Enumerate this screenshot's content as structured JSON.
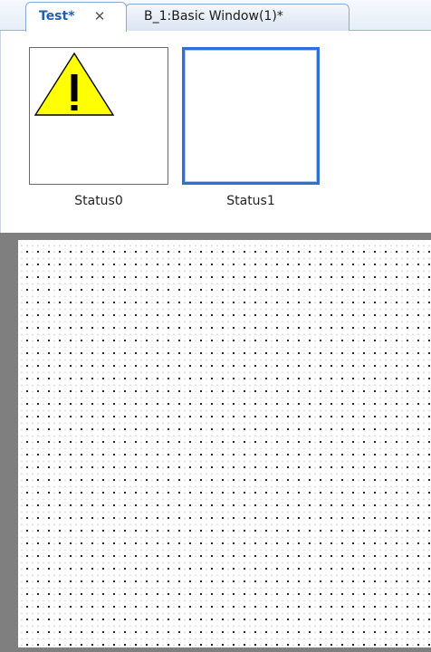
{
  "tabs": [
    {
      "label": "Test*",
      "close_glyph": "✕",
      "active": true
    },
    {
      "label": "B_1:Basic Window(1)*",
      "active": false
    }
  ],
  "statuses": [
    {
      "label": "Status0",
      "icon": "warning-triangle-icon",
      "selected": false
    },
    {
      "label": "Status1",
      "icon": "",
      "selected": true
    }
  ],
  "colors": {
    "active_tab_text": "#1f5fb3",
    "selection_border": "#2f6fd6",
    "warning_fill": "#ffff00",
    "canvas_frame": "#7f7f7f"
  }
}
